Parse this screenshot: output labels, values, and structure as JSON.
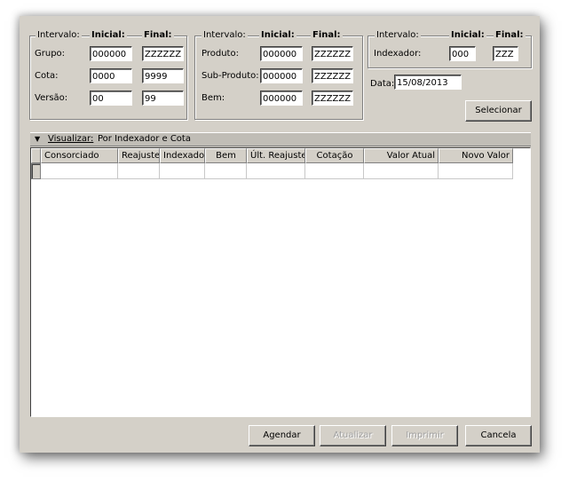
{
  "filters": {
    "g1": {
      "intervalo": "Intervalo:",
      "inicial": "Inicial:",
      "final": "Final:",
      "rows": [
        {
          "label": "Grupo:",
          "inicial": "000000",
          "final": "ZZZZZZ"
        },
        {
          "label": "Cota:",
          "inicial": "0000",
          "final": "9999"
        },
        {
          "label": "Versão:",
          "inicial": "00",
          "final": "99"
        }
      ]
    },
    "g2": {
      "intervalo": "Intervalo:",
      "inicial": "Inicial:",
      "final": "Final:",
      "rows": [
        {
          "label": "Produto:",
          "inicial": "000000",
          "final": "ZZZZZZ"
        },
        {
          "label": "Sub-Produto:",
          "inicial": "000000",
          "final": "ZZZZZZ"
        },
        {
          "label": "Bem:",
          "inicial": "000000",
          "final": "ZZZZZZ"
        }
      ]
    },
    "g3": {
      "intervalo": "Intervalo:",
      "inicial": "Inicial:",
      "final": "Final:",
      "rows": [
        {
          "label": "Indexador:",
          "inicial": "000",
          "final": "ZZZ"
        }
      ]
    },
    "data_label": "Data:",
    "data_value": "15/08/2013",
    "selecionar": "Selecionar"
  },
  "view": {
    "label": "Visualizar:",
    "value": "Por Indexador e Cota"
  },
  "table": {
    "columns": [
      "Consorciado",
      "Reajuste",
      "Indexador",
      "Bem",
      "Últ. Reajuste",
      "Cotação",
      "Valor Atual",
      "Novo Valor"
    ]
  },
  "buttons": {
    "agendar": "Agendar",
    "atualizar": "Atualizar",
    "imprimir": "Imprimir",
    "cancela": "Cancela"
  }
}
